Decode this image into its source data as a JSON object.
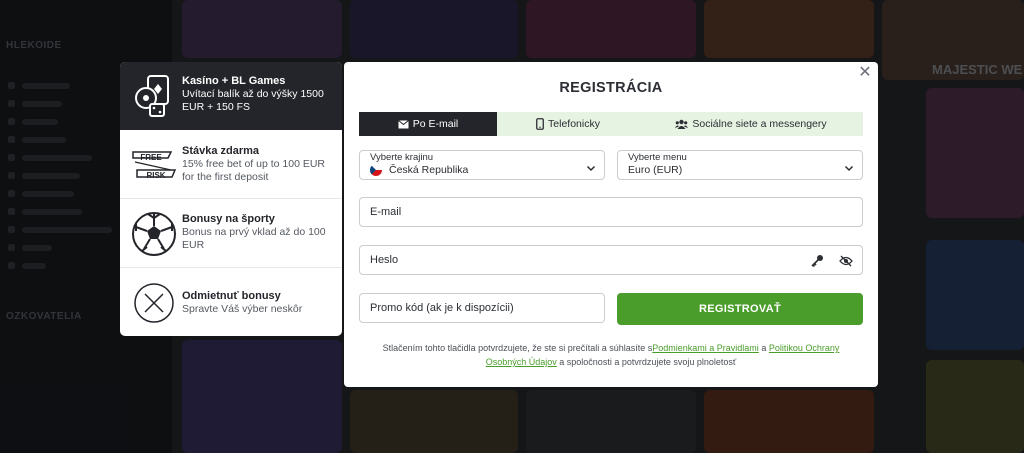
{
  "background": {
    "sidebar_heading_1": "HLEKOIDE",
    "sidebar_heading_2": "OZKOVATELIA",
    "tile_caption": "MAJESTIC WE",
    "colors": [
      "#5a3a7a",
      "#8a4a2a",
      "#3a6a8a",
      "#7a2a5a",
      "#2a6a4a",
      "#8a7a2a",
      "#4a3a8a",
      "#6a2a2a"
    ]
  },
  "bonuses": [
    {
      "icon": "dice-cards-icon",
      "title": "Kasíno + BL Games",
      "desc": "Uvítací balík až do výšky 1500 EUR + 150 FS",
      "active": true
    },
    {
      "icon": "free-risk-icon",
      "title": "Stávka zdarma",
      "desc": "15% free bet of up to 100 EUR for the first deposit",
      "icon_text_1": "FREE",
      "icon_text_2": "RISK"
    },
    {
      "icon": "soccer-ball-icon",
      "title": "Bonusy na športy",
      "desc": "Bonus na prvý vklad až do 100 EUR"
    },
    {
      "icon": "decline-x-icon",
      "title": "Odmietnuť bonusy",
      "desc": "Spravte Váš výber neskôr"
    }
  ],
  "modal": {
    "title": "REGISTRÁCIA",
    "close_icon": "close-icon",
    "tabs": [
      {
        "label": "Po E-mail",
        "icon": "envelope-icon",
        "active": true
      },
      {
        "label": "Telefonicky",
        "icon": "phone-icon",
        "active": false
      },
      {
        "label": "Sociálne siete a messengery",
        "icon": "users-icon",
        "active": false
      }
    ],
    "country": {
      "label": "Vyberte krajinu",
      "value": "Česká Republika",
      "flag": "czech-flag"
    },
    "currency": {
      "label": "Vyberte menu",
      "value": "Euro (EUR)"
    },
    "email_placeholder": "E-mail",
    "password_placeholder": "Heslo",
    "promo_placeholder": "Promo kód (ak je k dispozícii)",
    "register_label": "REGISTROVAŤ",
    "terms": {
      "prefix": "Stlačením tohto tlačidla potvrdzujete, že ste si prečítali a súhlasíte s",
      "link1": "Podmienkami a Pravidlami",
      "middle": " a ",
      "link2": "Politikou Ochrany Osobných Údajov",
      "suffix": " a spoločnosti a potvrdzujete svoju plnoletosť"
    },
    "colors": {
      "accent": "#4a9d2b",
      "dark": "#23252a",
      "tab_bg": "#e6f2e2"
    }
  }
}
